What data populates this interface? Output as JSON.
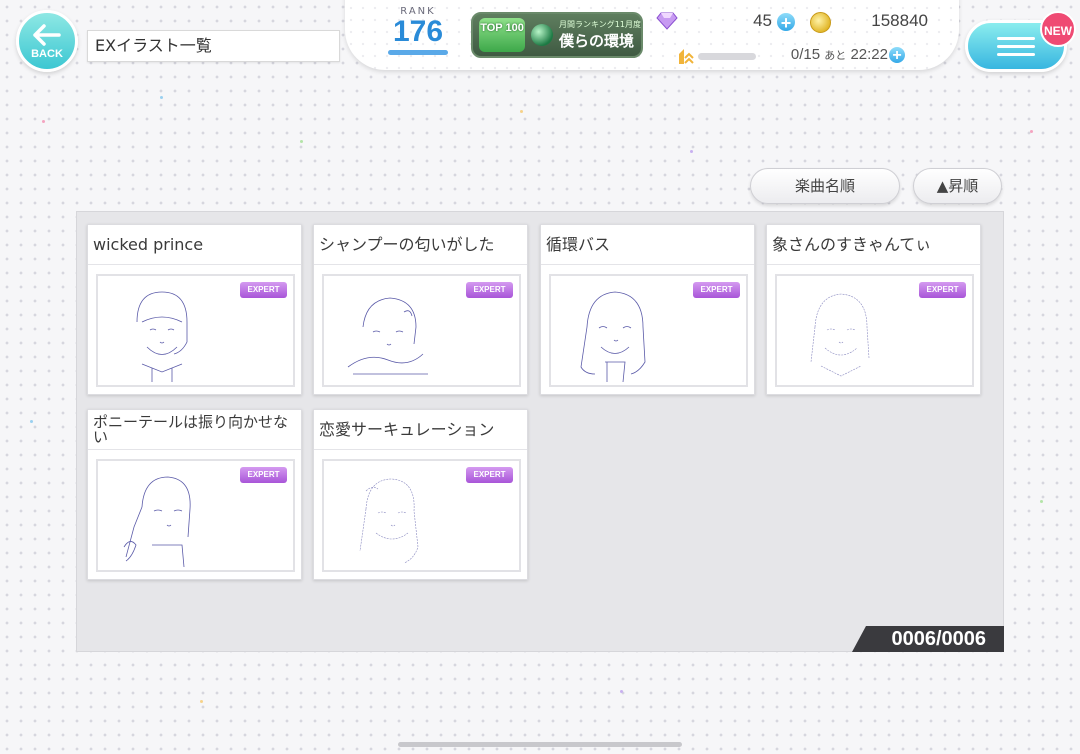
{
  "header": {
    "back_label": "BACK",
    "page_title": "EXイラスト一覧",
    "rank_label": "RANK",
    "rank_value": "176",
    "banner": {
      "badge": "TOP 100",
      "subtitle": "月間ランキング11月度",
      "title": "僕らの環境"
    },
    "gems": "45",
    "coins": "158840",
    "stamina": "0/15",
    "stamina_suffix": "あと",
    "stamina_timer": "22:22",
    "new_badge": "NEW"
  },
  "sort": {
    "order_label": "楽曲名順",
    "direction_label": "▲昇順"
  },
  "cards": [
    {
      "title": "wicked prince",
      "badge": "EXPERT"
    },
    {
      "title": "シャンプーの匂いがした",
      "badge": "EXPERT"
    },
    {
      "title": "循環バス",
      "badge": "EXPERT"
    },
    {
      "title": "象さんのすきゃんてぃ",
      "badge": "EXPERT"
    },
    {
      "title": "ポニーテールは振り向かせない",
      "badge": "EXPERT"
    },
    {
      "title": "恋愛サーキュレーション",
      "badge": "EXPERT"
    }
  ],
  "counter": "0006/0006",
  "colors": {
    "accent": "#3cc7d2",
    "rank": "#2a8bd8",
    "expert": "#a855d8",
    "new_badge": "#ef4a73"
  }
}
